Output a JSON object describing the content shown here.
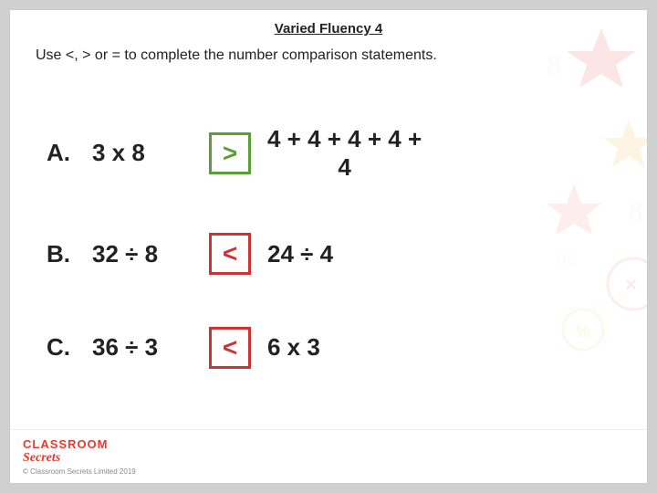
{
  "title": "Varied Fluency 4",
  "instruction": "Use <, > or = to complete the number comparison statements.",
  "problems": [
    {
      "label": "A.",
      "left_expr": "3 x 8",
      "symbol": ">",
      "symbol_color": "green",
      "right_expr": "4 + 4 + 4 + 4 + 4"
    },
    {
      "label": "B.",
      "left_expr": "32 ÷ 8",
      "symbol": "<",
      "symbol_color": "red",
      "right_expr": "24 ÷ 4"
    },
    {
      "label": "C.",
      "left_expr": "36 ÷ 3",
      "symbol": "<",
      "symbol_color": "red",
      "right_expr": "6 x 3"
    }
  ],
  "footer": {
    "brand": "CLASSROOM",
    "brand_sub": "Secrets",
    "copyright": "© Classroom Secrets Limited 2019"
  }
}
